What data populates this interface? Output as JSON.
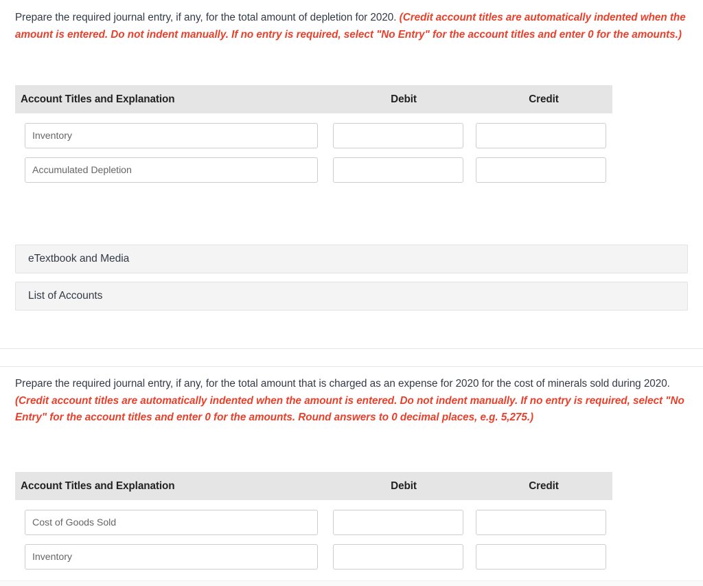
{
  "sections": [
    {
      "prompt_plain": "Prepare the required journal entry, if any, for the total amount of depletion for 2020. ",
      "prompt_note": "(Credit account titles are automatically indented when the amount is entered. Do not indent manually. If no entry is required, select \"No Entry\" for the account titles and enter 0 for the amounts.)",
      "table": {
        "headers": {
          "account": "Account Titles and Explanation",
          "debit": "Debit",
          "credit": "Credit"
        },
        "rows": [
          {
            "account": "Inventory",
            "debit": "",
            "credit": ""
          },
          {
            "account": "Accumulated Depletion",
            "debit": "",
            "credit": ""
          }
        ]
      }
    },
    {
      "prompt_plain": "Prepare the required journal entry, if any, for the total amount that is charged as an expense for 2020 for the cost of minerals sold during 2020. ",
      "prompt_note": "(Credit account titles are automatically indented when the amount is entered. Do not indent manually. If no entry is required, select \"No Entry\" for the account titles and enter 0 for the amounts. Round answers to 0 decimal places, e.g. 5,275.)",
      "table": {
        "headers": {
          "account": "Account Titles and Explanation",
          "debit": "Debit",
          "credit": "Credit"
        },
        "rows": [
          {
            "account": "Cost of Goods Sold",
            "debit": "",
            "credit": ""
          },
          {
            "account": "Inventory",
            "debit": "",
            "credit": ""
          }
        ]
      }
    }
  ],
  "actions": {
    "etextbook_label": "eTextbook and Media",
    "list_of_accounts_label": "List of Accounts"
  },
  "colors": {
    "note_red": "#e8412b",
    "text_dark": "#333a45",
    "header_band": "#e5e5e5",
    "button_bg": "#f4f4f4",
    "field_border": "#cdcdcd",
    "placeholder": "#666666"
  }
}
